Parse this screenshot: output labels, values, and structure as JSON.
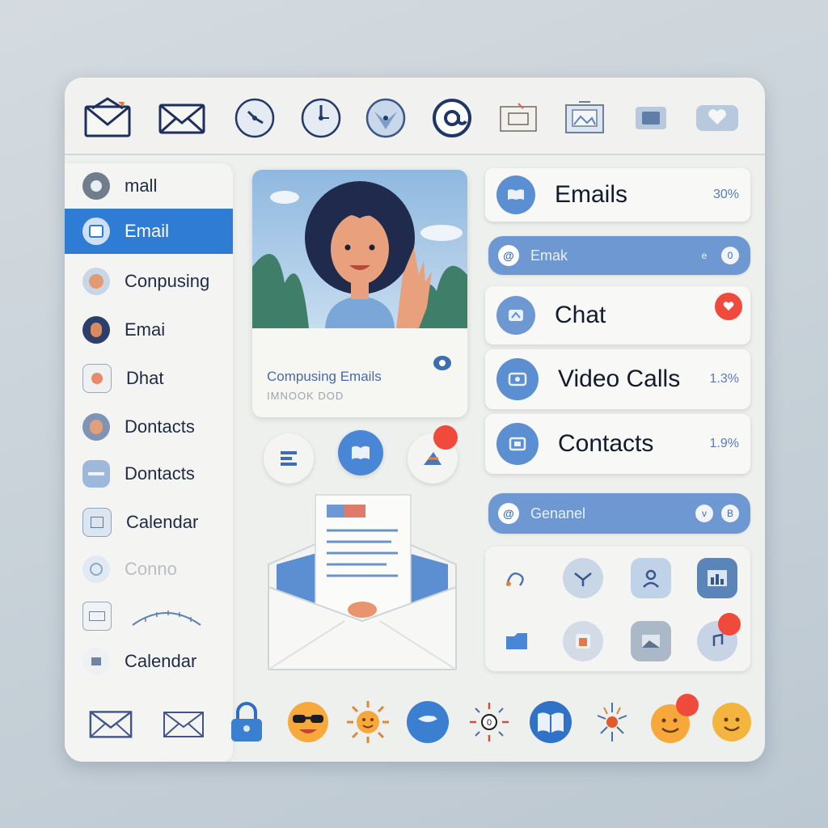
{
  "toolbar": {
    "icons": [
      "mail-icon",
      "envelope-icon",
      "clock-icon",
      "clock-icon",
      "clock-icon",
      "at-icon",
      "calendar-icon",
      "image-icon",
      "folder-icon",
      "heart-icon"
    ]
  },
  "sidebar": {
    "items": [
      {
        "label": "mall",
        "icon": "circle-icon"
      },
      {
        "label": "Email",
        "icon": "mail-icon",
        "active": true
      },
      {
        "label": "Conpusing",
        "icon": "avatar-icon"
      },
      {
        "label": "Emai",
        "icon": "avatar-icon"
      },
      {
        "label": "Dhat",
        "icon": "chat-icon"
      },
      {
        "label": "Dontacts",
        "icon": "avatar-icon"
      },
      {
        "label": "Dontacts",
        "icon": "folder-icon"
      },
      {
        "label": "Calendar",
        "icon": "calendar-icon"
      },
      {
        "label": "Conno",
        "icon": "heart-icon",
        "faded": true
      },
      {
        "label": "",
        "icon": "inbox-icon"
      },
      {
        "label": "Calendar",
        "icon": "video-icon"
      }
    ]
  },
  "compose_card": {
    "caption": "Compusing Emails",
    "subcaption": "IMNOOK DOD"
  },
  "rows": {
    "emails": {
      "label": "Emails",
      "meta": "30%"
    },
    "emails_pill": {
      "label": "Emak",
      "chip1": "e",
      "chip2": "0"
    },
    "chat": {
      "label": "Chat"
    },
    "video_calls": {
      "label": "Video Calls",
      "meta": "1.3%"
    },
    "contacts": {
      "label": "Contacts",
      "meta": "1.9%"
    },
    "general_pill": {
      "label": "Genanel",
      "chip1": "v",
      "chip2": "B"
    }
  },
  "colors": {
    "accent": "#2f7cd4",
    "pill": "#6d98d2",
    "badge": "#f04a3c",
    "text_dark": "#121a2c"
  },
  "bottom_bar": {
    "icons": [
      "mail-icon",
      "envelope-icon",
      "lock-icon",
      "sunglasses-emoji-icon",
      "sun-icon",
      "chat-bubble-icon",
      "compass-icon",
      "book-icon",
      "spark-icon",
      "smile-emoji-icon",
      "smile-emoji-icon"
    ]
  }
}
